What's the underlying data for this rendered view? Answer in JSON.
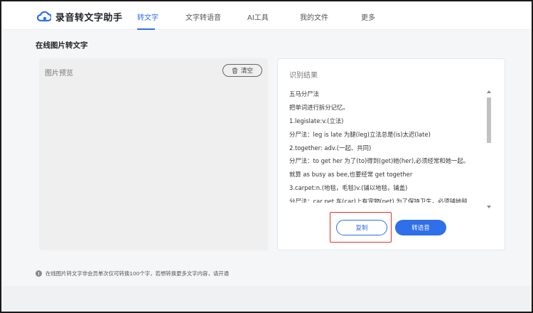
{
  "header": {
    "logo_text": "录音转文字助手",
    "nav": [
      {
        "label": "转文字",
        "active": true
      },
      {
        "label": "文字转语音",
        "active": false
      },
      {
        "label": "AI工具",
        "active": false
      },
      {
        "label": "我的文件",
        "active": false
      },
      {
        "label": "更多",
        "active": false
      }
    ]
  },
  "page": {
    "title": "在线图片转文字"
  },
  "preview": {
    "label": "图片预览",
    "clear_label": "清空"
  },
  "result": {
    "label": "识别结果",
    "lines": [
      "五马分尸法",
      "把单词进行拆分记忆。",
      "1.legislate:v.(立法)",
      "分尸法：leg is late 为腿(leg)立法总是(is)太迟(late)",
      "2.together: adv.(一起、共同)",
      "分尸法：to get her 为了(to)得到(get)她(her),必须经常和她一起。",
      "就算 as busy as bee,也要经常 get together",
      "3.carpet:n.(地毯，毛毯)v.(铺以地毯，铺盖)",
      "分尸法：car pet 车(car)上有宠物(pet),为了保持卫生，必须铺地毯"
    ],
    "copy_label": "复制",
    "convert_label": "转语音"
  },
  "notice": {
    "icon": "info-icon",
    "text": "在线图片转文字非会员单次仅可转换100个字，若想转换更多文字内容，请开通"
  },
  "colors": {
    "accent": "#2f6fe9",
    "highlight": "#e0302a"
  }
}
